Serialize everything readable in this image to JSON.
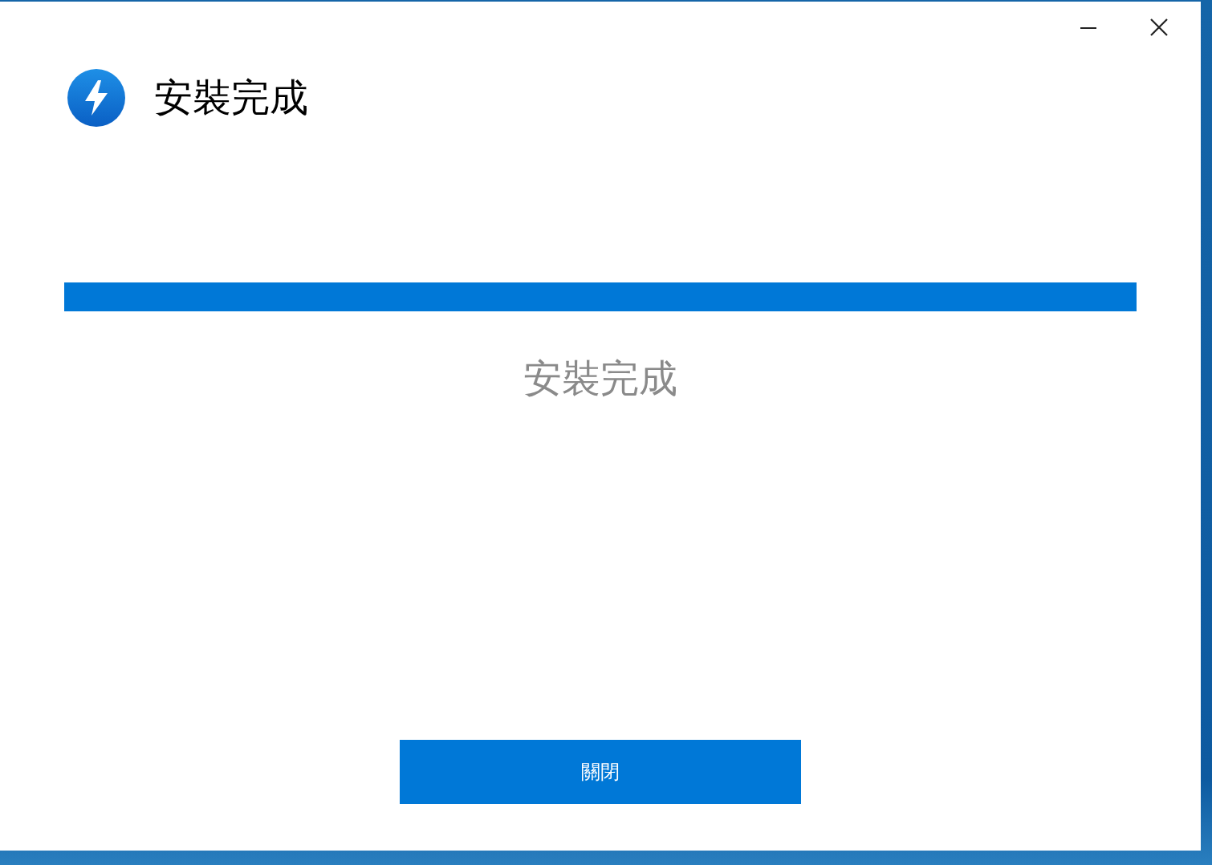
{
  "header": {
    "title": "安裝完成"
  },
  "progress": {
    "level": 1
  },
  "status": "安裝完成",
  "buttons": [
    {
      "label": "關閉"
    }
  ]
}
